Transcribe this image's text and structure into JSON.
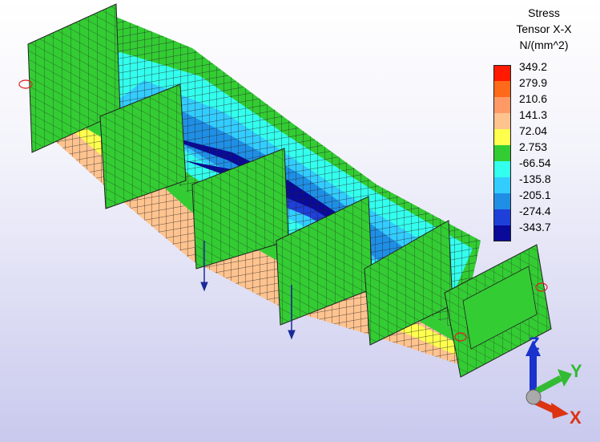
{
  "legend": {
    "title_lines": [
      "Stress",
      "Tensor X-X",
      "N/(mm^2)"
    ],
    "entries": [
      {
        "label": "349.2",
        "color": "#ff1a00"
      },
      {
        "label": "279.9",
        "color": "#ff6a1a"
      },
      {
        "label": "210.6",
        "color": "#ff9a66"
      },
      {
        "label": "141.3",
        "color": "#ffc38f"
      },
      {
        "label": "72.04",
        "color": "#ffff4d"
      },
      {
        "label": "2.753",
        "color": "#33cc33"
      },
      {
        "label": "-66.54",
        "color": "#33ffee"
      },
      {
        "label": "-135.8",
        "color": "#33ccff"
      },
      {
        "label": "-205.1",
        "color": "#1f8fe6"
      },
      {
        "label": "-274.4",
        "color": "#1f3fd9"
      },
      {
        "label": "-343.7",
        "color": "#0a0a99"
      }
    ]
  },
  "axes": {
    "z_label": "Z",
    "y_label": "Y",
    "x_label": "X",
    "z_color": "#1a33cc",
    "y_color": "#33bb33",
    "x_color": "#dd3311"
  },
  "model": {
    "mesh_line_color": "#2a2a2a",
    "load_arrow_color": "#1a2a99"
  }
}
